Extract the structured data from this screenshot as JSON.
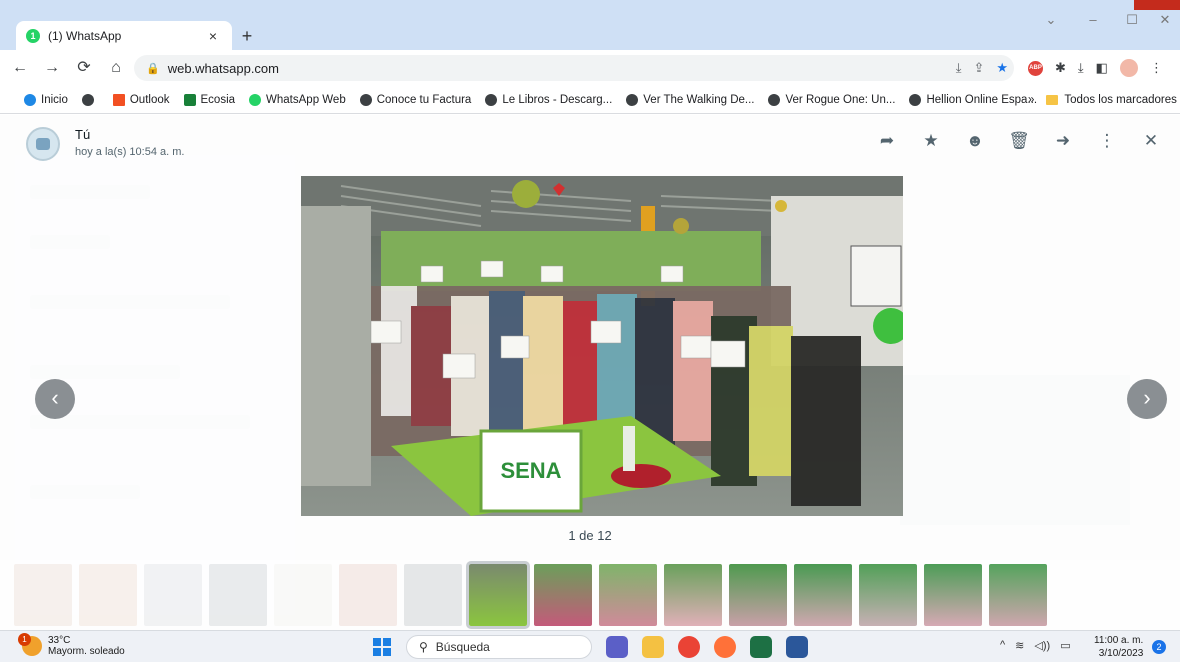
{
  "browser": {
    "tab_title": "(1) WhatsApp",
    "tab_badge": "1",
    "address": "web.whatsapp.com",
    "bookmarks": [
      "Inicio",
      "Outlook",
      "Ecosia",
      "WhatsApp Web",
      "Conoce tu Factura",
      "Le Libros - Descarg...",
      "Ver The Walking De...",
      "Ver Rogue One: Un...",
      "Hellion Online Espa..."
    ],
    "bookmarks_more": "»",
    "all_bookmarks": "Todos los marcadores"
  },
  "viewer": {
    "sender": "Tú",
    "timestamp": "hoy a la(s) 10:54 a. m.",
    "counter": "1 de 12",
    "photo_caption": "SENA"
  },
  "taskbar": {
    "temperature": "33°C",
    "weather_desc": "Mayorm. soleado",
    "weather_badge": "1",
    "search_placeholder": "Búsqueda",
    "time": "11:00 a. m.",
    "date": "3/10/2023",
    "notifications": "2"
  },
  "colors": {
    "accent": "#1a73e8",
    "whatsapp": "#25d366",
    "tab_strip": "#cfe0f5"
  }
}
